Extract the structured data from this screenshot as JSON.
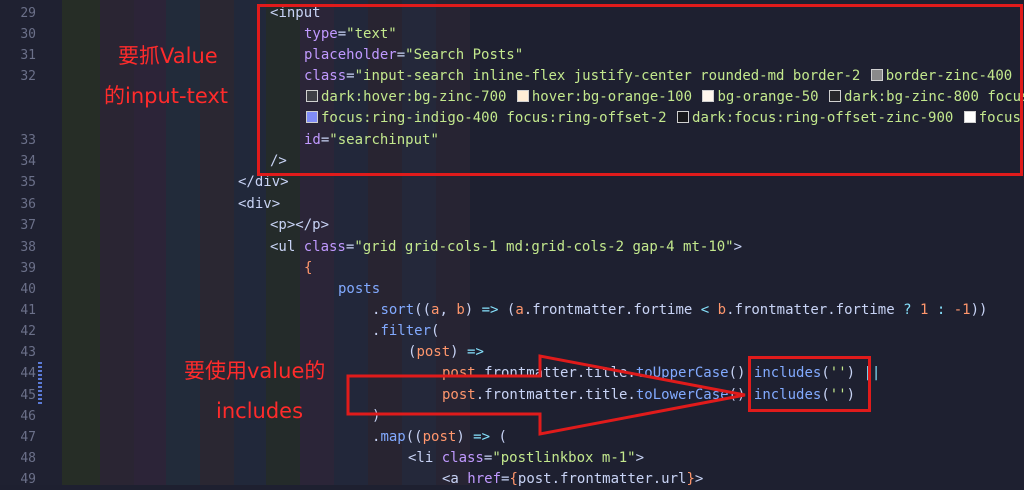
{
  "annotations": {
    "grab_value_line1": "要抓Value",
    "grab_value_line2": "的input-text",
    "use_value_line1": "要使用value的",
    "use_value_line2": "includes"
  },
  "lines": [
    {
      "n": "29",
      "tokens": [
        [
          "<",
          "t-tag"
        ],
        [
          "input",
          "t-tag"
        ]
      ]
    },
    {
      "n": "30",
      "tokens": [
        [
          "type",
          "t-attr"
        ],
        [
          "=",
          "t-pun"
        ],
        [
          "\"text\"",
          "t-str"
        ]
      ]
    },
    {
      "n": "31",
      "tokens": [
        [
          "placeholder",
          "t-attr"
        ],
        [
          "=",
          "t-pun"
        ],
        [
          "\"Search Posts\"",
          "t-str"
        ]
      ]
    },
    {
      "n": "32",
      "tokens": [
        [
          "class",
          "t-attr"
        ],
        [
          "=",
          "t-pun"
        ],
        [
          "\"input-search inline-flex justify-center rounded-md border-2 ",
          "t-str"
        ],
        [
          "■",
          "sw:#8a8a8a"
        ],
        [
          "border-zinc-400",
          "t-str"
        ]
      ]
    },
    {
      "n": "",
      "tokens": [
        [
          "□",
          "sw:#3f3f46"
        ],
        [
          "dark:hover:bg-zinc-700 ",
          "t-str"
        ],
        [
          "■",
          "sw:#ffedd5"
        ],
        [
          "hover:bg-orange-100 ",
          "t-str"
        ],
        [
          "■",
          "sw:#fff7ed"
        ],
        [
          "bg-orange-50 ",
          "t-str"
        ],
        [
          "□",
          "sw:#27272a"
        ],
        [
          "dark:bg-zinc-800 focus",
          "t-str"
        ]
      ]
    },
    {
      "n": "",
      "tokens": [
        [
          "■",
          "sw:#818cf8"
        ],
        [
          "focus:ring-indigo-400 focus:ring-offset-2 ",
          "t-str"
        ],
        [
          "□",
          "sw:#18181b"
        ],
        [
          "dark:focus:ring-offset-zinc-900 ",
          "t-str"
        ],
        [
          "■",
          "sw:#ffffff"
        ],
        [
          "focus",
          "t-str"
        ]
      ]
    },
    {
      "n": "33",
      "tokens": [
        [
          "id",
          "t-attr"
        ],
        [
          "=",
          "t-pun"
        ],
        [
          "\"searchinput\"",
          "t-str"
        ]
      ]
    },
    {
      "n": "34",
      "tokens": [
        [
          "/>",
          "t-tag"
        ]
      ]
    },
    {
      "n": "35",
      "tokens": [
        [
          "</div>",
          "t-tag"
        ]
      ]
    },
    {
      "n": "36",
      "tokens": [
        [
          "<div>",
          "t-tag"
        ]
      ]
    },
    {
      "n": "37",
      "tokens": [
        [
          "<p></p>",
          "t-tag"
        ]
      ]
    },
    {
      "n": "38",
      "tokens": [
        [
          "<ul ",
          "t-tag"
        ],
        [
          "class",
          "t-attr"
        ],
        [
          "=",
          "t-pun"
        ],
        [
          "\"grid grid-cols-1 md:grid-cols-2 gap-4 mt-10\"",
          "t-str"
        ],
        [
          ">",
          "t-tag"
        ]
      ]
    },
    {
      "n": "39",
      "tokens": [
        [
          "{",
          "t-kw"
        ]
      ]
    },
    {
      "n": "40",
      "tokens": [
        [
          "posts",
          "t-mem"
        ]
      ]
    },
    {
      "n": "41",
      "tokens": [
        [
          ".",
          "t-pun"
        ],
        [
          "sort",
          "t-mem"
        ],
        [
          "((",
          "t-pun"
        ],
        [
          "a",
          "t-kw"
        ],
        [
          ", ",
          "t-pun"
        ],
        [
          "b",
          "t-kw"
        ],
        [
          ") ",
          "t-pun"
        ],
        [
          "=>",
          "t-op"
        ],
        [
          " (",
          "t-pun"
        ],
        [
          "a",
          "t-kw"
        ],
        [
          ".frontmatter.fortime ",
          "t-pun"
        ],
        [
          "<",
          "t-op"
        ],
        [
          " ",
          "t-pun"
        ],
        [
          "b",
          "t-kw"
        ],
        [
          ".frontmatter.fortime ",
          "t-pun"
        ],
        [
          "?",
          "t-op"
        ],
        [
          " ",
          "t-pun"
        ],
        [
          "1",
          "t-num"
        ],
        [
          " ",
          "t-pun"
        ],
        [
          ":",
          "t-op"
        ],
        [
          " ",
          "t-pun"
        ],
        [
          "-1",
          "t-num"
        ],
        [
          "))",
          "t-pun"
        ]
      ]
    },
    {
      "n": "42",
      "tokens": [
        [
          ".",
          "t-pun"
        ],
        [
          "filter",
          "t-mem"
        ],
        [
          "(",
          "t-pun"
        ]
      ]
    },
    {
      "n": "43",
      "tokens": [
        [
          "(",
          "t-pun"
        ],
        [
          "post",
          "t-kw"
        ],
        [
          ") ",
          "t-pun"
        ],
        [
          "=>",
          "t-op"
        ]
      ]
    },
    {
      "n": "44",
      "tokens": [
        [
          "post",
          "t-kw"
        ],
        [
          ".frontmatter.title.",
          "t-pun"
        ],
        [
          "toUpperCase",
          "t-mem"
        ],
        [
          "().",
          "t-pun"
        ],
        [
          "includes",
          "t-mem"
        ],
        [
          "(",
          "t-pun"
        ],
        [
          "''",
          "t-str"
        ],
        [
          ") ",
          "t-pun"
        ],
        [
          "||",
          "t-op"
        ]
      ]
    },
    {
      "n": "45",
      "tokens": [
        [
          "post",
          "t-kw"
        ],
        [
          ".frontmatter.title.",
          "t-pun"
        ],
        [
          "toLowerCase",
          "t-mem"
        ],
        [
          "().",
          "t-pun"
        ],
        [
          "includes",
          "t-mem"
        ],
        [
          "(",
          "t-pun"
        ],
        [
          "''",
          "t-str"
        ],
        [
          ")",
          "t-pun"
        ]
      ]
    },
    {
      "n": "46",
      "tokens": [
        [
          ")",
          "t-pun"
        ]
      ]
    },
    {
      "n": "47",
      "tokens": [
        [
          ".",
          "t-pun"
        ],
        [
          "map",
          "t-mem"
        ],
        [
          "((",
          "t-pun"
        ],
        [
          "post",
          "t-kw"
        ],
        [
          ") ",
          "t-pun"
        ],
        [
          "=>",
          "t-op"
        ],
        [
          " (",
          "t-pun"
        ]
      ]
    },
    {
      "n": "48",
      "tokens": [
        [
          "<li ",
          "t-tag"
        ],
        [
          "class",
          "t-attr"
        ],
        [
          "=",
          "t-pun"
        ],
        [
          "\"postlinkbox m-1\"",
          "t-str"
        ],
        [
          ">",
          "t-tag"
        ]
      ]
    },
    {
      "n": "49",
      "tokens": [
        [
          "<a ",
          "t-tag"
        ],
        [
          "href",
          "t-attr"
        ],
        [
          "=",
          "t-pun"
        ],
        [
          "{",
          "t-kw"
        ],
        [
          "post.frontmatter.url",
          "t-pun"
        ],
        [
          "}",
          "t-kw"
        ],
        [
          ">",
          "t-tag"
        ]
      ]
    }
  ]
}
